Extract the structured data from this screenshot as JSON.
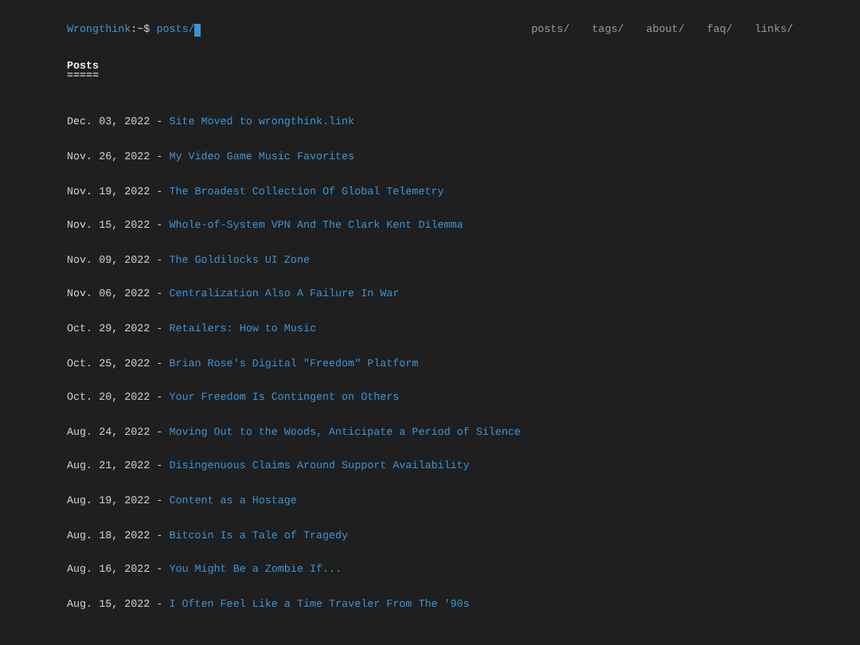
{
  "header": {
    "prompt_host": "Wrongthink",
    "prompt_sep": ":~$",
    "prompt_path": "posts/",
    "nav": [
      {
        "label": "posts/"
      },
      {
        "label": "tags/"
      },
      {
        "label": "about/"
      },
      {
        "label": "faq/"
      },
      {
        "label": "links/"
      }
    ]
  },
  "heading": {
    "title": "Posts",
    "underline": "====="
  },
  "posts": [
    {
      "date": "Dec. 03, 2022",
      "sep": "-",
      "title": "Site Moved to wrongthink.link"
    },
    {
      "date": "Nov. 26, 2022",
      "sep": "-",
      "title": "My Video Game Music Favorites"
    },
    {
      "date": "Nov. 19, 2022",
      "sep": "-",
      "title": "The Broadest Collection Of Global Telemetry"
    },
    {
      "date": "Nov. 15, 2022",
      "sep": "-",
      "title": "Whole-of-System VPN And The Clark Kent Dilemma"
    },
    {
      "date": "Nov. 09, 2022",
      "sep": "-",
      "title": "The Goldilocks UI Zone"
    },
    {
      "date": "Nov. 06, 2022",
      "sep": "-",
      "title": "Centralization Also A Failure In War"
    },
    {
      "date": "Oct. 29, 2022",
      "sep": "-",
      "title": "Retailers: How to Music"
    },
    {
      "date": "Oct. 25, 2022",
      "sep": "-",
      "title": "Brian Rose's Digital \"Freedom\" Platform"
    },
    {
      "date": "Oct. 20, 2022",
      "sep": "-",
      "title": "Your Freedom Is Contingent on Others"
    },
    {
      "date": "Aug. 24, 2022",
      "sep": "-",
      "title": "Moving Out to the Woods, Anticipate a Period of Silence"
    },
    {
      "date": "Aug. 21, 2022",
      "sep": "-",
      "title": "Disingenuous Claims Around Support Availability"
    },
    {
      "date": "Aug. 19, 2022",
      "sep": "-",
      "title": "Content as a Hostage"
    },
    {
      "date": "Aug. 18, 2022",
      "sep": "-",
      "title": "Bitcoin Is a Tale of Tragedy"
    },
    {
      "date": "Aug. 16, 2022",
      "sep": "-",
      "title": "You Might Be a Zombie If..."
    },
    {
      "date": "Aug. 15, 2022",
      "sep": "-",
      "title": "I Often Feel Like a Time Traveler From The '90s"
    }
  ]
}
